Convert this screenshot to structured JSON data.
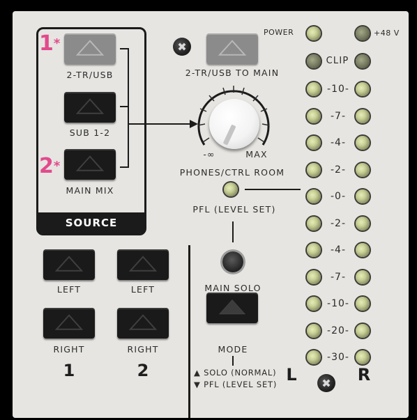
{
  "source": {
    "title": "SOURCE",
    "buttons": [
      {
        "label": "2-TR/USB",
        "marker": "1",
        "marker_suffix": "*"
      },
      {
        "label": "SUB 1-2"
      },
      {
        "label": "MAIN MIX",
        "marker": "2",
        "marker_suffix": "*"
      }
    ]
  },
  "to_main": {
    "label": "2-TR/USB TO MAIN"
  },
  "knob": {
    "label": "PHONES/CTRL ROOM",
    "min_label": "-∞",
    "max_label": "MAX"
  },
  "pfl_label": "PFL (LEVEL SET)",
  "main_solo": {
    "label": "MAIN SOLO"
  },
  "mode": {
    "label": "MODE",
    "up_note": "▲ SOLO (NORMAL)",
    "down_note": "▼ PFL (LEVEL SET)"
  },
  "group_buttons": [
    {
      "top": "LEFT",
      "bottom": "RIGHT",
      "number": "1"
    },
    {
      "top": "LEFT",
      "bottom": "RIGHT",
      "number": "2"
    }
  ],
  "meter": {
    "power": "POWER",
    "phantom": "+48 V",
    "clip": "CLIP",
    "levels": [
      "10",
      "7",
      "4",
      "2",
      "0",
      "2",
      "4",
      "7",
      "10",
      "20",
      "30"
    ],
    "left": "L",
    "right": "R"
  },
  "colors": {
    "panel": "#e6e5e1",
    "marker": "#e24a8c",
    "ink": "#1b1b1b"
  }
}
